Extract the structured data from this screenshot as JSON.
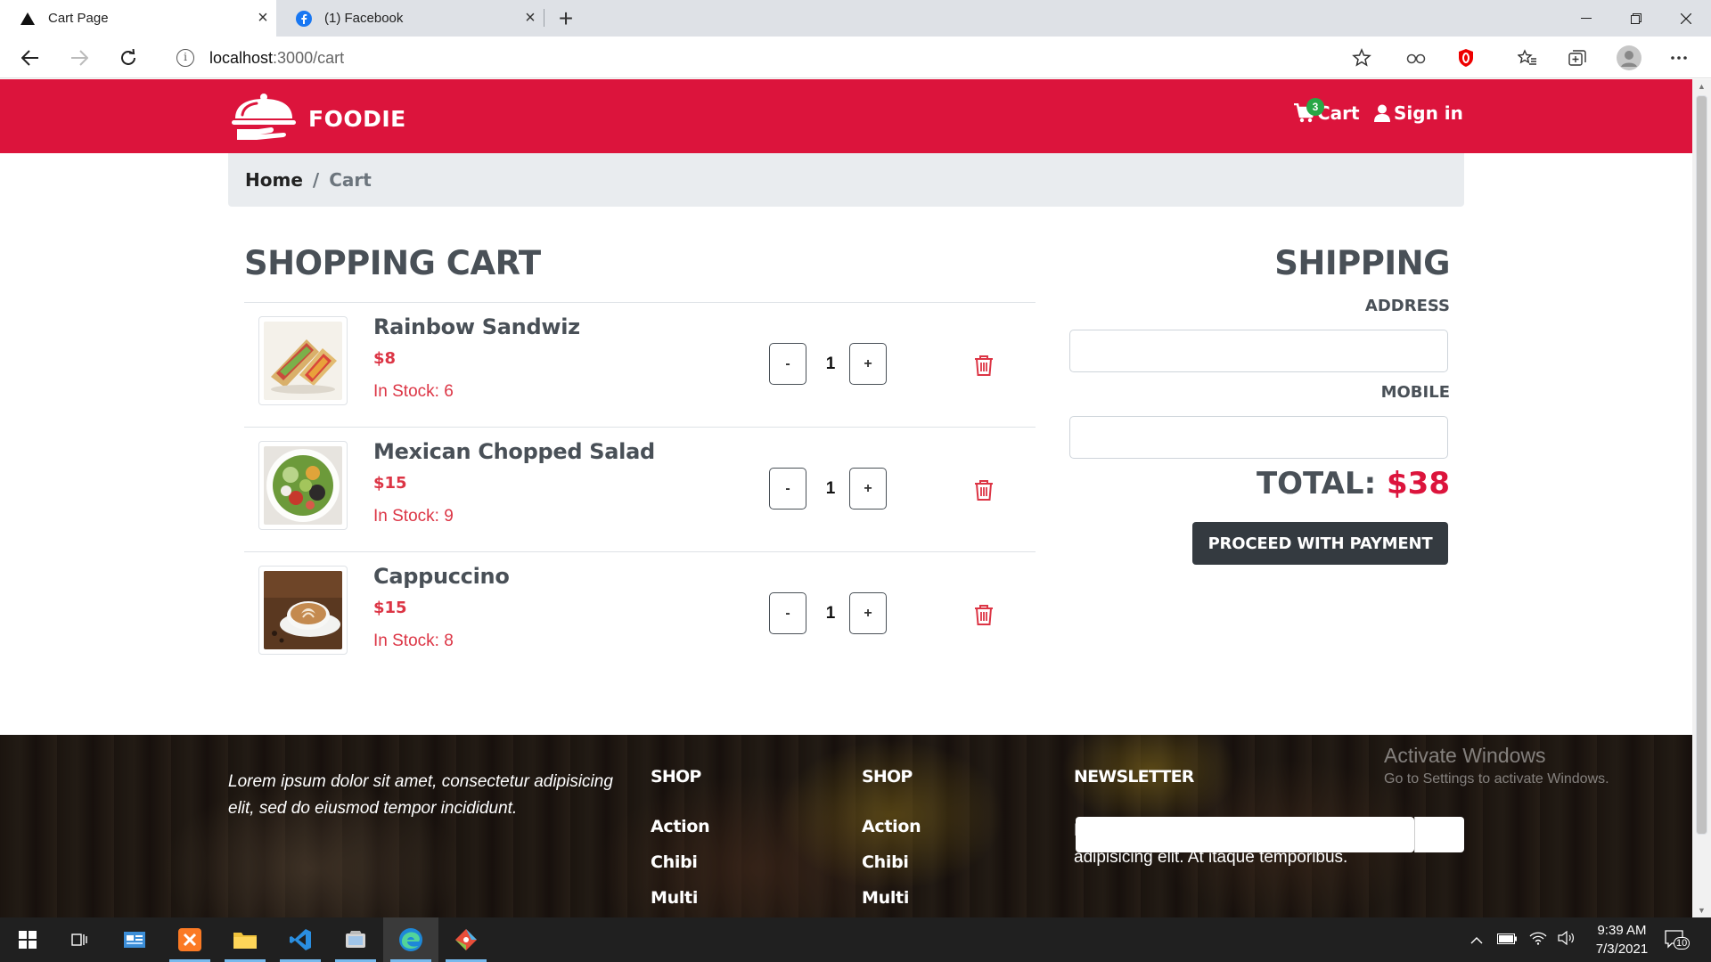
{
  "browser": {
    "tabs": [
      {
        "title": "Cart Page",
        "active": true
      },
      {
        "title": "(1) Facebook",
        "active": false
      }
    ],
    "url": {
      "host": "localhost",
      "path": ":3000/cart"
    }
  },
  "header": {
    "brand": "FOODIE",
    "cart_label": "Cart",
    "cart_count": "3",
    "signin_label": "Sign in"
  },
  "breadcrumb": {
    "home": "Home",
    "separator": "/",
    "current": "Cart"
  },
  "cart": {
    "title": "SHOPPING CART",
    "items": [
      {
        "name": "Rainbow Sandwiz",
        "price": "$8",
        "stock": "In Stock: 6",
        "qty": "1",
        "minus": "-",
        "plus": "+"
      },
      {
        "name": "Mexican Chopped Salad",
        "price": "$15",
        "stock": "In Stock: 9",
        "qty": "1",
        "minus": "-",
        "plus": "+"
      },
      {
        "name": "Cappuccino",
        "price": "$15",
        "stock": "In Stock: 8",
        "qty": "1",
        "minus": "-",
        "plus": "+"
      }
    ]
  },
  "shipping": {
    "title": "SHIPPING",
    "address_label": "ADDRESS",
    "address_value": "",
    "mobile_label": "MOBILE",
    "mobile_value": "",
    "total_label": "TOTAL:",
    "total_value": "$38",
    "proceed_label": "PROCEED WITH PAYMENT"
  },
  "footer": {
    "about": "Lorem ipsum dolor sit amet, consectetur adipisicing elit, sed do eiusmod tempor incididunt.",
    "col1": {
      "heading": "SHOP",
      "links": [
        "Action",
        "Chibi",
        "Multi"
      ]
    },
    "col2": {
      "heading": "SHOP",
      "links": [
        "Action",
        "Chibi",
        "Multi"
      ]
    },
    "newsletter": {
      "heading": "NEWSLETTER",
      "text": "Lorem ipsum dolor sit amet, consectetur adipisicing elit. At itaque temporibus."
    }
  },
  "watermark": {
    "line1": "Activate Windows",
    "line2": "Go to Settings to activate Windows."
  },
  "taskbar": {
    "time": "9:39 AM",
    "date": "7/3/2021",
    "notifications": "10"
  },
  "colors": {
    "brand": "#dc143c",
    "text_dark": "#495057",
    "danger": "#dc3545",
    "button_dark": "#343a40",
    "badge": "#28a745"
  }
}
